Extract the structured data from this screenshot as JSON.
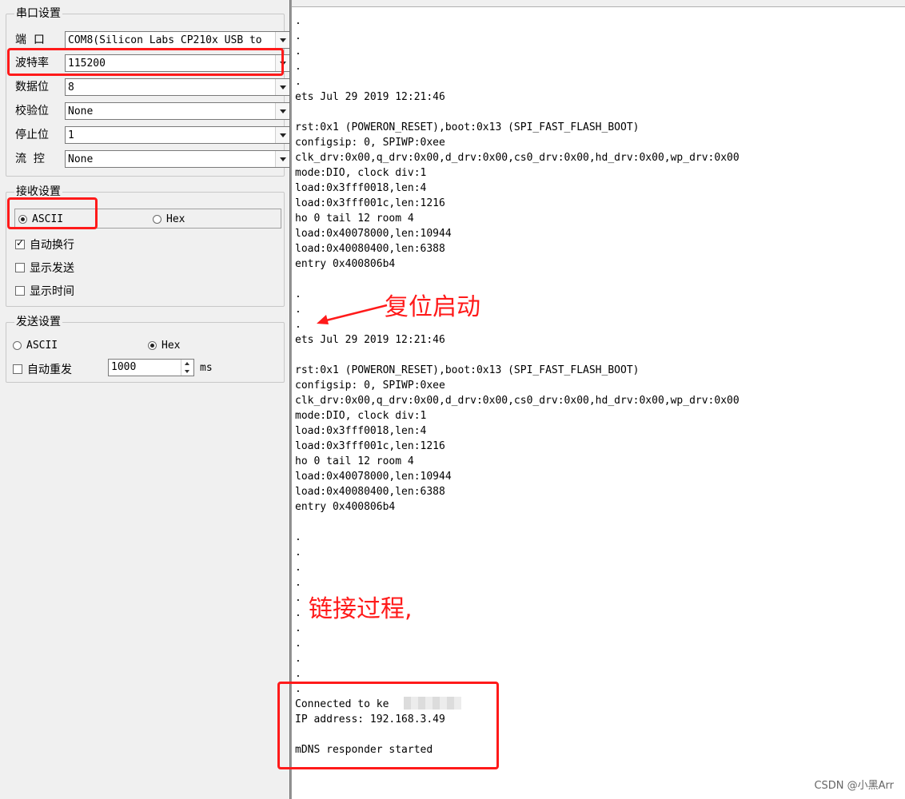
{
  "serial": {
    "title": "串口设置",
    "rows": [
      {
        "label": "端  口",
        "value": "COM8(Silicon Labs CP210x USB to"
      },
      {
        "label": "波特率",
        "value": "115200"
      },
      {
        "label": "数据位",
        "value": "8"
      },
      {
        "label": "校验位",
        "value": "None"
      },
      {
        "label": "停止位",
        "value": "1"
      },
      {
        "label": "流  控",
        "value": "None"
      }
    ]
  },
  "receive": {
    "title": "接收设置",
    "mode_ascii": "ASCII",
    "mode_hex": "Hex",
    "selected_mode": "ASCII",
    "checks": [
      {
        "label": "自动换行",
        "checked": true
      },
      {
        "label": "显示发送",
        "checked": false
      },
      {
        "label": "显示时间",
        "checked": false
      }
    ]
  },
  "send": {
    "title": "发送设置",
    "mode_ascii": "ASCII",
    "mode_hex": "Hex",
    "selected_mode": "Hex",
    "auto_resend_label": "自动重发",
    "auto_resend_checked": false,
    "interval_value": "1000",
    "interval_unit": "ms"
  },
  "terminal": {
    "lines": [
      ".",
      ".",
      ".",
      ".",
      ".",
      "ets Jul 29 2019 12:21:46",
      "",
      "rst:0x1 (POWERON_RESET),boot:0x13 (SPI_FAST_FLASH_BOOT)",
      "configsip: 0, SPIWP:0xee",
      "clk_drv:0x00,q_drv:0x00,d_drv:0x00,cs0_drv:0x00,hd_drv:0x00,wp_drv:0x00",
      "mode:DIO, clock div:1",
      "load:0x3fff0018,len:4",
      "load:0x3fff001c,len:1216",
      "ho 0 tail 12 room 4",
      "load:0x40078000,len:10944",
      "load:0x40080400,len:6388",
      "entry 0x400806b4",
      "",
      ".",
      ".",
      ".",
      "ets Jul 29 2019 12:21:46",
      "",
      "rst:0x1 (POWERON_RESET),boot:0x13 (SPI_FAST_FLASH_BOOT)",
      "configsip: 0, SPIWP:0xee",
      "clk_drv:0x00,q_drv:0x00,d_drv:0x00,cs0_drv:0x00,hd_drv:0x00,wp_drv:0x00",
      "mode:DIO, clock div:1",
      "load:0x3fff0018,len:4",
      "load:0x3fff001c,len:1216",
      "ho 0 tail 12 room 4",
      "load:0x40078000,len:10944",
      "load:0x40080400,len:6388",
      "entry 0x400806b4",
      "",
      ".",
      ".",
      ".",
      ".",
      ".",
      ".",
      ".",
      ".",
      ".",
      ".",
      ".",
      "Connected to ke",
      "IP address: 192.168.3.49",
      "",
      "mDNS responder started"
    ]
  },
  "annotations": {
    "reset_boot": "复位启动",
    "connecting": "链接过程,"
  },
  "watermark": "CSDN @小黑Arr",
  "colors": {
    "highlight": "#ff1a1a",
    "panel": "#f0f0f0",
    "terminal_bg": "#ffffff"
  }
}
